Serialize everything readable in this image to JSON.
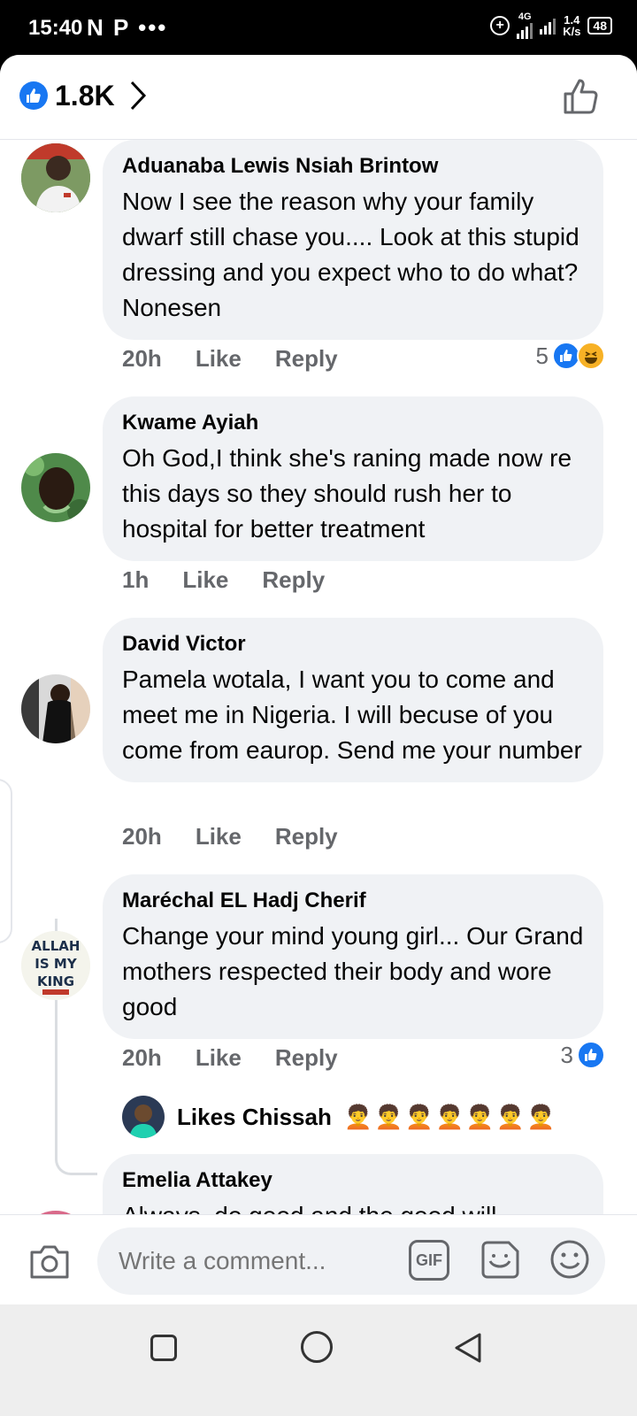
{
  "status_bar": {
    "time": "15:40",
    "left_icons": "N P •••",
    "network": "4G",
    "speed_value": "1.4",
    "speed_unit": "K/s",
    "battery": "48"
  },
  "header": {
    "like_count": "1.8K",
    "like_icon": "like-icon",
    "chevron_icon": "chevron-right-icon",
    "thumb_icon": "thumbs-up-outline-icon"
  },
  "comments": [
    {
      "author": "Aduanaba Lewis Nsiah Brintow",
      "text": "Now I see the reason why your family dwarf still chase you.... Look at this stupid dressing and you expect who to do what? Nonesen",
      "time": "20h",
      "like_label": "Like",
      "reply_label": "Reply",
      "reaction_count": "5",
      "reactions": [
        "like",
        "haha"
      ]
    },
    {
      "author": "Kwame Ayiah",
      "text": "Oh God,I think she's raning made now re this days so they should rush her to hospital for better  treatment",
      "time": "1h",
      "like_label": "Like",
      "reply_label": "Reply"
    },
    {
      "author": "David Victor",
      "text": "Pamela wotala, I want you to come and meet me in Nigeria. I will becuse of you come from eaurop. Send me your number",
      "time": "20h",
      "like_label": "Like",
      "reply_label": "Reply"
    },
    {
      "author": "Maréchal EL Hadj Cherif",
      "text": "Change your mind young girl... Our Grand mothers respected their body and wore good",
      "time": "20h",
      "like_label": "Like",
      "reply_label": "Reply",
      "reaction_count": "3",
      "reactions": [
        "like"
      ],
      "avatar_text": [
        "ALLAH",
        "IS MY",
        "KING"
      ],
      "reply_preview": {
        "name": "Likes Chissah",
        "emojis": "🧑‍🦱🧑‍🦱🧑‍🦱🧑‍🦱🧑‍🦱🧑‍🦱🧑‍🦱"
      }
    },
    {
      "author": "Emelia Attakey",
      "text": "Always, do good and the good will"
    }
  ],
  "composer": {
    "placeholder": "Write a comment...",
    "gif_label": "GIF"
  },
  "colors": {
    "accent": "#1877f2",
    "bubble": "#f0f2f5",
    "meta": "#65676b"
  }
}
